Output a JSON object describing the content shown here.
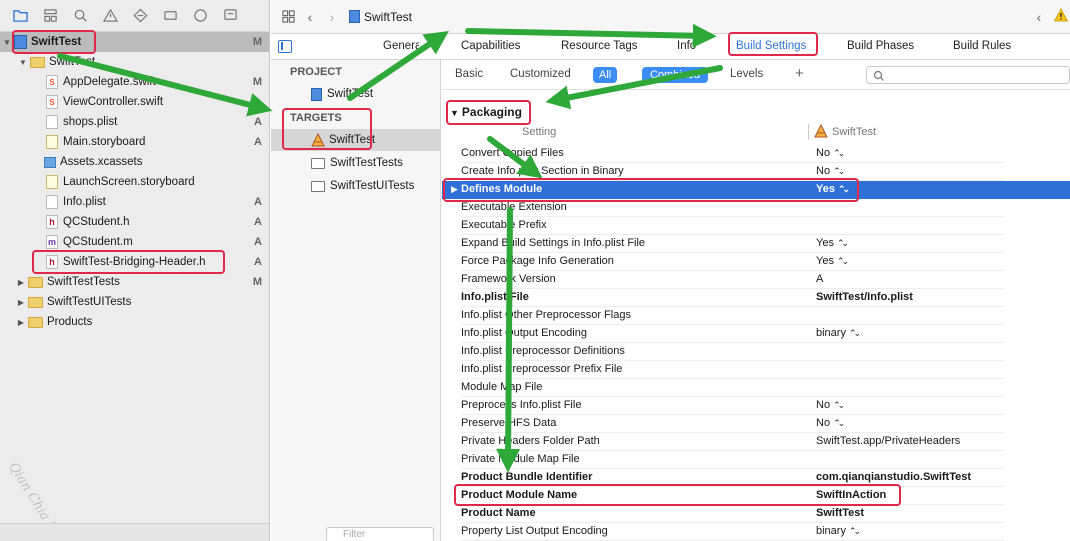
{
  "editor": {
    "file_name": "SwiftTest"
  },
  "navigator": {
    "items": [
      {
        "label": "SwiftTest",
        "badge": "M"
      },
      {
        "label": "SwiftTest",
        "badge": ""
      },
      {
        "label": "AppDelegate.swift",
        "badge": "M"
      },
      {
        "label": "ViewController.swift",
        "badge": ""
      },
      {
        "label": "shops.plist",
        "badge": "A"
      },
      {
        "label": "Main.storyboard",
        "badge": "A"
      },
      {
        "label": "Assets.xcassets",
        "badge": ""
      },
      {
        "label": "LaunchScreen.storyboard",
        "badge": ""
      },
      {
        "label": "Info.plist",
        "badge": "A"
      },
      {
        "label": "QCStudent.h",
        "badge": "A"
      },
      {
        "label": "QCStudent.m",
        "badge": "A"
      },
      {
        "label": "SwiftTest-Bridging-Header.h",
        "badge": "A"
      },
      {
        "label": "SwiftTestTests",
        "badge": "M"
      },
      {
        "label": "SwiftTestUITests",
        "badge": ""
      },
      {
        "label": "Products",
        "badge": ""
      }
    ],
    "watermark": "Qian Chia Blog"
  },
  "tabs": {
    "general": "General",
    "capabilities": "Capabilities",
    "resource_tags": "Resource Tags",
    "info": "Info",
    "build_settings": "Build Settings",
    "build_phases": "Build Phases",
    "build_rules": "Build Rules"
  },
  "targets_panel": {
    "project_header": "PROJECT",
    "project_item": "SwiftTest",
    "targets_header": "TARGETS",
    "targets": [
      "SwiftTest",
      "SwiftTestTests",
      "SwiftTestUITests"
    ],
    "filter_placeholder": "Filter"
  },
  "filter_bar": {
    "basic": "Basic",
    "customized": "Customized",
    "all": "All",
    "combined": "Combined",
    "levels": "Levels",
    "add": "+"
  },
  "settings": {
    "section_title": "Packaging",
    "column_setting": "Setting",
    "column_target": "SwiftTest",
    "rows": [
      {
        "name": "Convert Copied Files",
        "value": "No",
        "stepper": true,
        "bold": false
      },
      {
        "name": "Create Info.plist Section in Binary",
        "value": "No",
        "stepper": true,
        "bold": false
      },
      {
        "name": "Defines Module",
        "value": "Yes",
        "stepper": true,
        "bold": true
      },
      {
        "name": "Executable Extension",
        "value": "",
        "stepper": false,
        "bold": false
      },
      {
        "name": "Executable Prefix",
        "value": "",
        "stepper": false,
        "bold": false
      },
      {
        "name": "Expand Build Settings in Info.plist File",
        "value": "Yes",
        "stepper": true,
        "bold": false
      },
      {
        "name": "Force Package Info Generation",
        "value": "Yes",
        "stepper": true,
        "bold": false
      },
      {
        "name": "Framework Version",
        "value": "A",
        "stepper": false,
        "bold": false
      },
      {
        "name": "Info.plist File",
        "value": "SwiftTest/Info.plist",
        "stepper": false,
        "bold": true
      },
      {
        "name": "Info.plist Other Preprocessor Flags",
        "value": "",
        "stepper": false,
        "bold": false
      },
      {
        "name": "Info.plist Output Encoding",
        "value": "binary",
        "stepper": true,
        "bold": false
      },
      {
        "name": "Info.plist Preprocessor Definitions",
        "value": "",
        "stepper": false,
        "bold": false
      },
      {
        "name": "Info.plist Preprocessor Prefix File",
        "value": "",
        "stepper": false,
        "bold": false
      },
      {
        "name": "Module Map File",
        "value": "",
        "stepper": false,
        "bold": false
      },
      {
        "name": "Preprocess Info.plist File",
        "value": "No",
        "stepper": true,
        "bold": false
      },
      {
        "name": "Preserve HFS Data",
        "value": "No",
        "stepper": true,
        "bold": false
      },
      {
        "name": "Private Headers Folder Path",
        "value": "SwiftTest.app/PrivateHeaders",
        "stepper": false,
        "bold": false
      },
      {
        "name": "Private Module Map File",
        "value": "",
        "stepper": false,
        "bold": false
      },
      {
        "name": "Product Bundle Identifier",
        "value": "com.qianqianstudio.SwiftTest",
        "stepper": false,
        "bold": true
      },
      {
        "name": "Product Module Name",
        "value": "SwiftInAction",
        "stepper": false,
        "bold": true
      },
      {
        "name": "Product Name",
        "value": "SwiftTest",
        "stepper": false,
        "bold": true
      },
      {
        "name": "Property List Output Encoding",
        "value": "binary",
        "stepper": true,
        "bold": false
      }
    ]
  },
  "colors": {
    "accent": "#2f74d9",
    "row_highlight": "#2f6fd6",
    "annotation_box": "#e0284a",
    "annotation_arrow": "#2fa83a"
  }
}
